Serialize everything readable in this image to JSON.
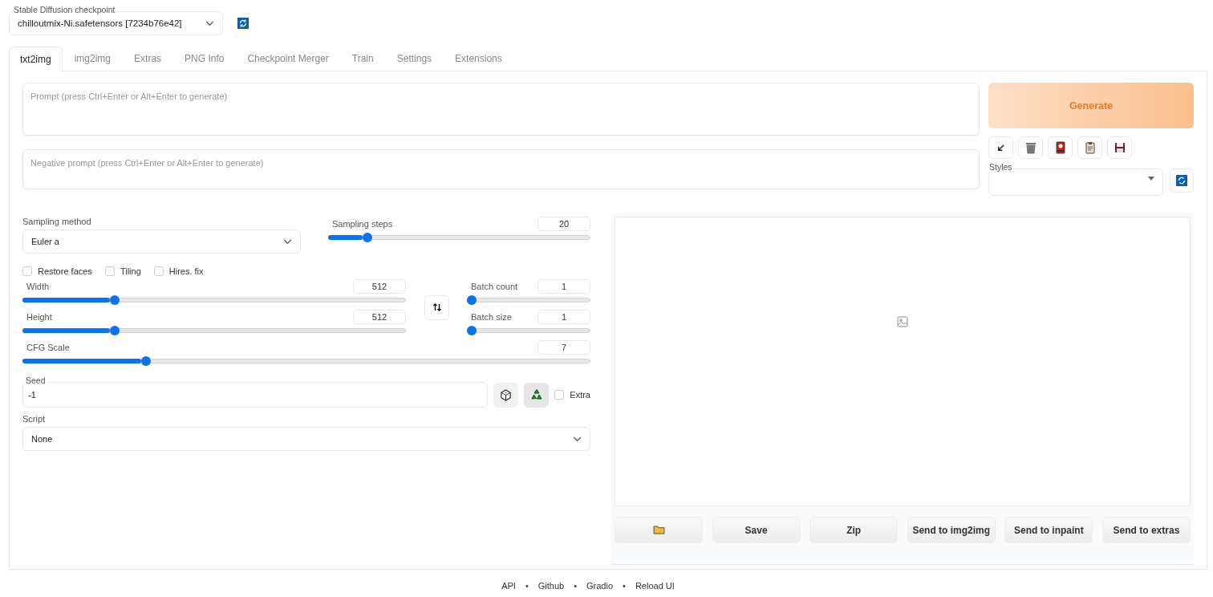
{
  "checkpoint": {
    "label": "Stable Diffusion checkpoint",
    "value": "chilloutmix-Ni.safetensors [7234b76e42]"
  },
  "tabs": [
    {
      "label": "txt2img",
      "selected": true
    },
    {
      "label": "img2img",
      "selected": false
    },
    {
      "label": "Extras",
      "selected": false
    },
    {
      "label": "PNG Info",
      "selected": false
    },
    {
      "label": "Checkpoint Merger",
      "selected": false
    },
    {
      "label": "Train",
      "selected": false
    },
    {
      "label": "Settings",
      "selected": false
    },
    {
      "label": "Extensions",
      "selected": false
    }
  ],
  "prompt": {
    "placeholder": "Prompt (press Ctrl+Enter or Alt+Enter to generate)"
  },
  "negative_prompt": {
    "placeholder": "Negative prompt (press Ctrl+Enter or Alt+Enter to generate)"
  },
  "generate": {
    "label": "Generate"
  },
  "styles": {
    "label": "Styles"
  },
  "sampling_method": {
    "label": "Sampling method",
    "value": "Euler a"
  },
  "sampling_steps": {
    "label": "Sampling steps",
    "value": "20",
    "level": 0.135
  },
  "options": [
    {
      "label": "Restore faces",
      "checked": false
    },
    {
      "label": "Tiling",
      "checked": false
    },
    {
      "label": "Hires. fix",
      "checked": false
    }
  ],
  "size_sliders": [
    {
      "label": "Width",
      "value": "512",
      "level": 0.233
    },
    {
      "label": "Height",
      "value": "512",
      "level": 0.233
    }
  ],
  "batch_sliders": [
    {
      "label": "Batch count",
      "value": "1",
      "level": 0
    },
    {
      "label": "Batch size",
      "value": "1",
      "level": 0
    }
  ],
  "cfg_scale": {
    "label": "CFG Scale",
    "value": "7",
    "level": 0.212
  },
  "seed": {
    "label": "Seed",
    "value": "-1",
    "extra_label": "Extra",
    "extra_checked": false
  },
  "script": {
    "label": "Script",
    "value": "None"
  },
  "output_buttons": [
    {
      "kind": "folder"
    },
    {
      "kind": "text",
      "label": "Save"
    },
    {
      "kind": "text",
      "label": "Zip"
    },
    {
      "kind": "text",
      "label": "Send to img2img"
    },
    {
      "kind": "text",
      "label": "Send to inpaint"
    },
    {
      "kind": "text",
      "label": "Send to extras"
    }
  ],
  "footer": {
    "links": [
      "API",
      "Github",
      "Gradio",
      "Reload UI"
    ],
    "separators": [
      "•",
      "•",
      "•"
    ]
  }
}
